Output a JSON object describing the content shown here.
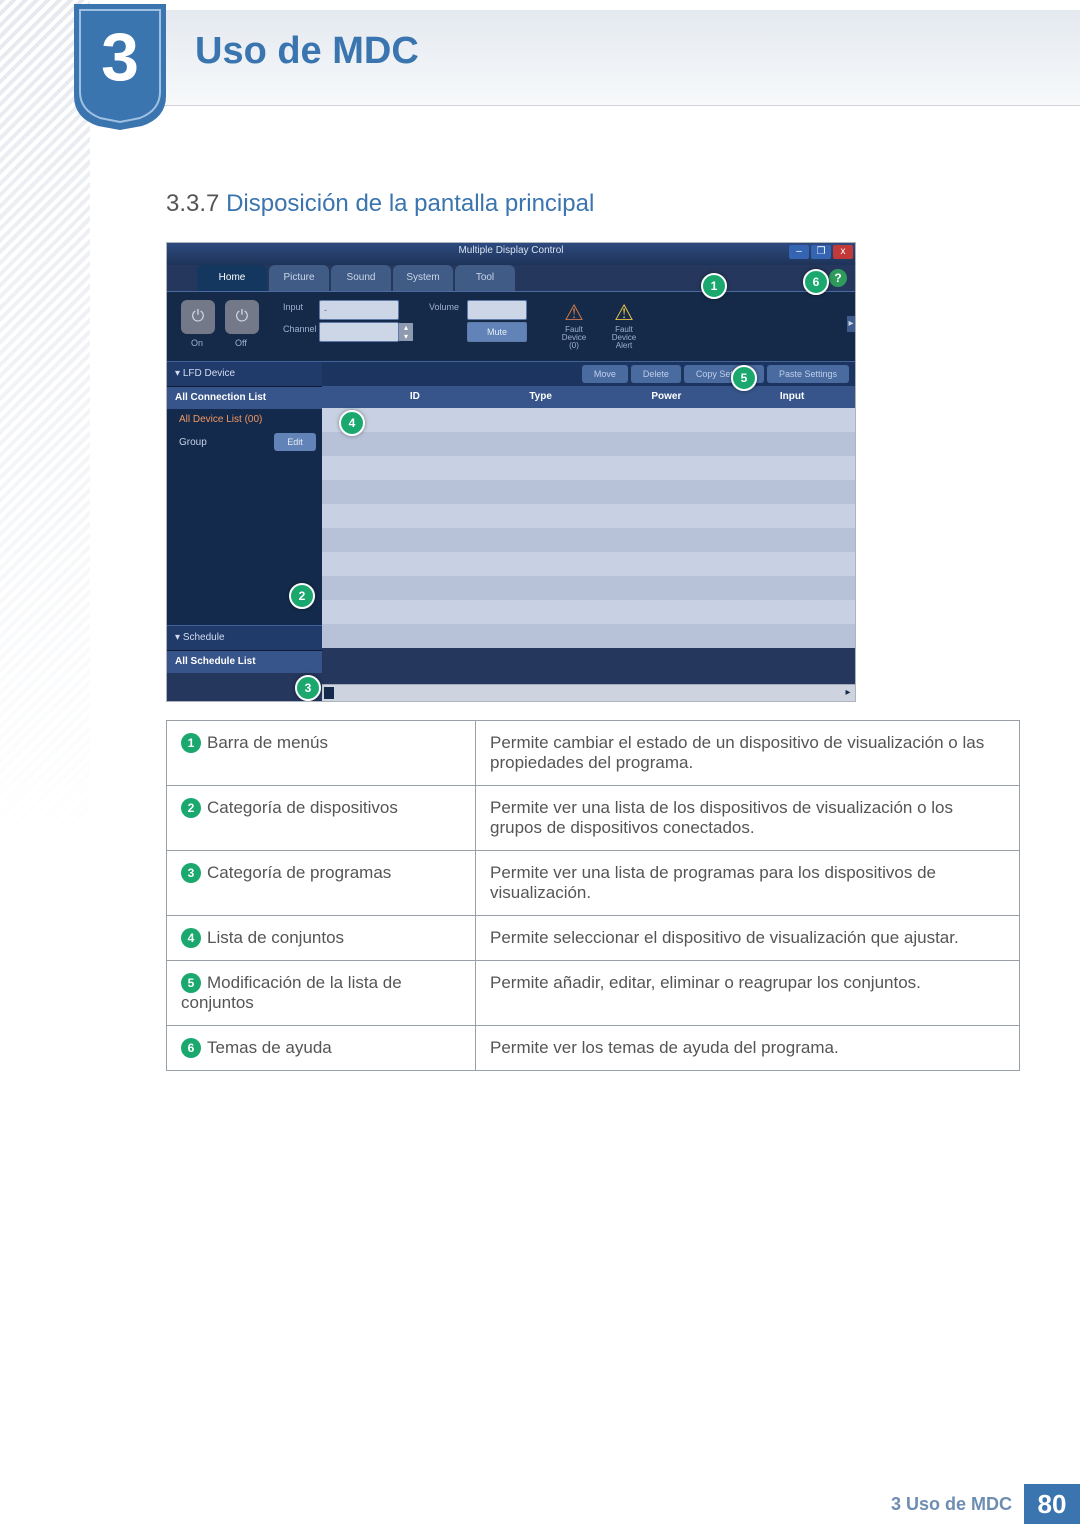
{
  "chapter": {
    "number": "3",
    "title": "Uso de MDC"
  },
  "section": {
    "number": "3.3.7",
    "title": "Disposición de la pantalla principal"
  },
  "footer": {
    "text": "3 Uso de MDC",
    "page": "80"
  },
  "screenshot": {
    "window_title": "Multiple Display Control",
    "win_buttons": {
      "min": "–",
      "max": "❐",
      "close": "x"
    },
    "tabs": [
      "Home",
      "Picture",
      "Sound",
      "System",
      "Tool"
    ],
    "ribbon": {
      "on": "On",
      "off": "Off",
      "input_label": "Input",
      "input_value": "-",
      "channel_label": "Channel",
      "volume_label": "Volume",
      "volume_value": "",
      "mute_btn": "Mute",
      "fault_device": "Fault Device (0)",
      "fault_alert": "Fault Device Alert",
      "scroll": "▸"
    },
    "sidebar": {
      "lfd": "LFD Device",
      "all_conn": "All Connection List",
      "all_dev": "All Device List (00)",
      "group": "Group",
      "edit": "Edit",
      "schedule": "Schedule",
      "all_sched": "All Schedule List"
    },
    "tools": [
      "Move",
      "Delete",
      "Copy Settings",
      "Paste Settings"
    ],
    "columns": [
      "ID",
      "Type",
      "Power",
      "Input"
    ]
  },
  "callouts": {
    "1": "1",
    "2": "2",
    "3": "3",
    "4": "4",
    "5": "5",
    "6": "6"
  },
  "legend": [
    {
      "n": "1",
      "label": "Barra de menús",
      "desc": "Permite cambiar el estado de un dispositivo de visualización o las propiedades del programa."
    },
    {
      "n": "2",
      "label": "Categoría de dispositivos",
      "desc": "Permite ver una lista de los dispositivos de visualización o los grupos de dispositivos conectados."
    },
    {
      "n": "3",
      "label": "Categoría de programas",
      "desc": "Permite ver una lista de programas para los dispositivos de visualización."
    },
    {
      "n": "4",
      "label": "Lista de conjuntos",
      "desc": "Permite seleccionar el dispositivo de visualización que ajustar."
    },
    {
      "n": "5",
      "label": "Modificación de la lista de conjuntos",
      "desc": "Permite añadir, editar, eliminar o reagrupar los conjuntos."
    },
    {
      "n": "6",
      "label": "Temas de ayuda",
      "desc": "Permite ver los temas de ayuda del programa."
    }
  ]
}
